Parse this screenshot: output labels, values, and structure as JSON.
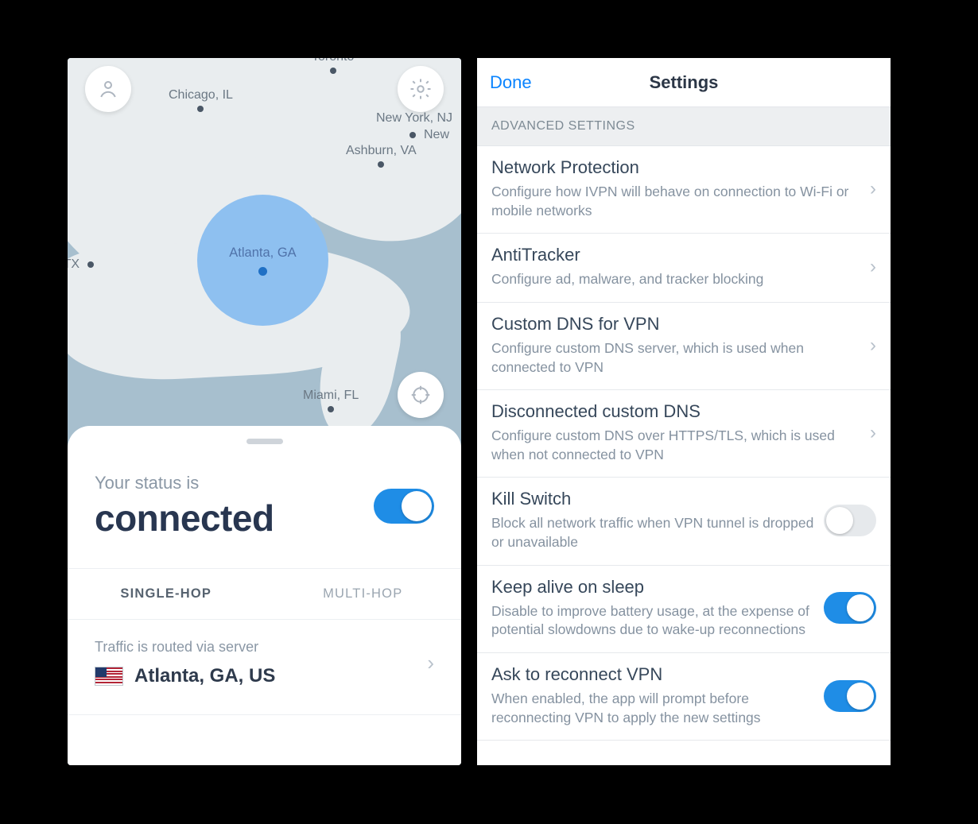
{
  "main": {
    "map": {
      "server": {
        "name": "Atlanta, GA"
      },
      "cities": [
        {
          "name": "Toronto"
        },
        {
          "name": "Chicago, IL"
        },
        {
          "name": "New York, NJ"
        },
        {
          "name": "New"
        },
        {
          "name": "Ashburn, VA"
        },
        {
          "name": "s, TX"
        },
        {
          "name": "Miami, FL"
        }
      ]
    },
    "status": {
      "prefix": "Your status is",
      "state": "connected",
      "toggle_on": true
    },
    "tabs": {
      "single": "SINGLE-HOP",
      "multi": "MULTI-HOP",
      "active": "single"
    },
    "route": {
      "caption": "Traffic is routed via server",
      "location": "Atlanta, GA, US",
      "flag": "us"
    }
  },
  "settings": {
    "done_label": "Done",
    "title": "Settings",
    "section_header": "ADVANCED SETTINGS",
    "items": [
      {
        "title": "Network Protection",
        "subtitle": "Configure how IVPN will behave on connection to Wi-Fi or mobile networks",
        "type": "link"
      },
      {
        "title": "AntiTracker",
        "subtitle": "Configure ad, malware, and tracker blocking",
        "type": "link"
      },
      {
        "title": "Custom DNS for VPN",
        "subtitle": "Configure custom DNS server, which is used when connected to VPN",
        "type": "link"
      },
      {
        "title": "Disconnected custom DNS",
        "subtitle": "Configure custom DNS over HTTPS/TLS, which is used when not connected to VPN",
        "type": "link"
      },
      {
        "title": "Kill Switch",
        "subtitle": "Block all network traffic when VPN tunnel is dropped or unavailable",
        "type": "toggle",
        "on": false
      },
      {
        "title": "Keep alive on sleep",
        "subtitle": "Disable to improve battery usage, at the expense of potential slowdowns due to wake-up reconnections",
        "type": "toggle",
        "on": true
      },
      {
        "title": "Ask to reconnect VPN",
        "subtitle": "When enabled, the app will prompt before reconnecting VPN to apply the new settings",
        "type": "toggle",
        "on": true
      }
    ]
  },
  "colors": {
    "accent": "#1f8de6",
    "text_primary": "#2e3a4c",
    "text_secondary": "#8a97a5"
  }
}
